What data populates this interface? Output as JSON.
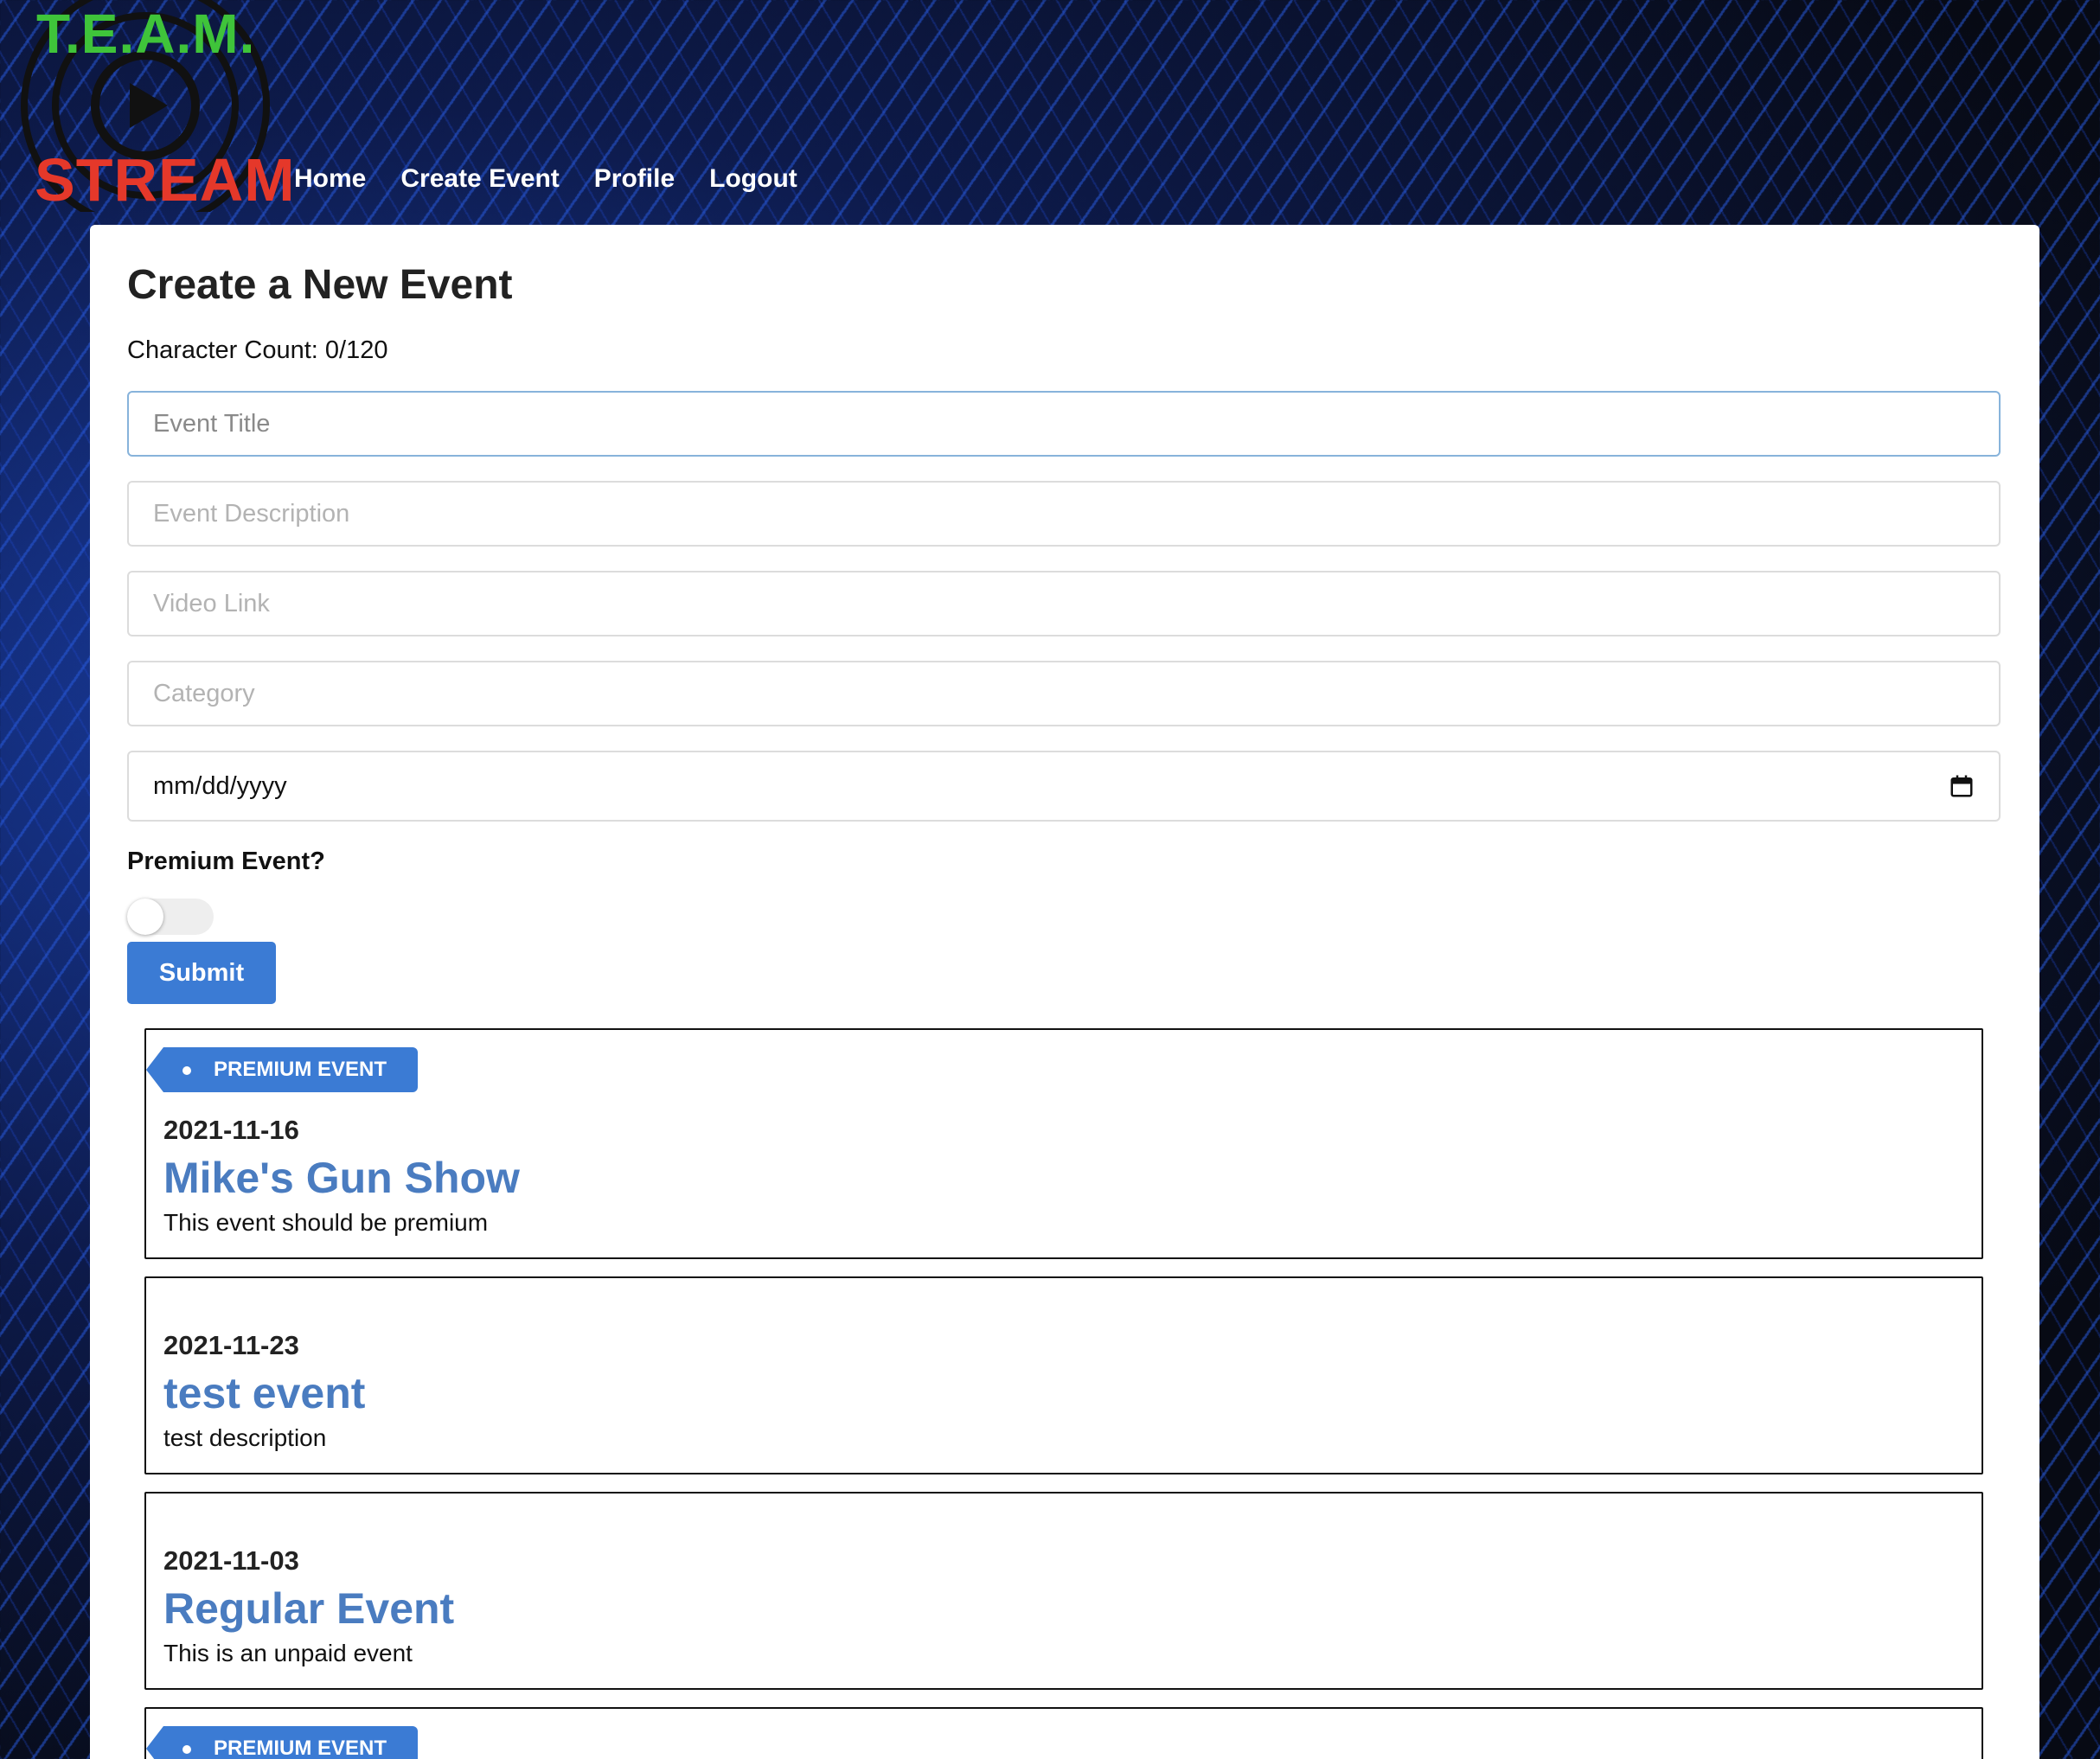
{
  "brand": {
    "top": "T.E.A.M.",
    "bottom": "STREAM"
  },
  "nav": {
    "items": [
      {
        "label": "Home"
      },
      {
        "label": "Create Event"
      },
      {
        "label": "Profile"
      },
      {
        "label": "Logout"
      }
    ]
  },
  "form": {
    "title": "Create a New Event",
    "char_count": "Character Count: 0/120",
    "fields": {
      "title_placeholder": "Event Title",
      "description_placeholder": "Event Description",
      "video_placeholder": "Video Link",
      "category_placeholder": "Category",
      "date_value": "mm/dd/yyyy"
    },
    "premium_label": "Premium Event?",
    "premium_enabled": false,
    "submit_label": "Submit"
  },
  "events": [
    {
      "premium": true,
      "tag": "PREMIUM EVENT",
      "date": "2021-11-16",
      "title": "Mike's Gun Show",
      "description": "This event should be premium"
    },
    {
      "premium": false,
      "date": "2021-11-23",
      "title": "test event",
      "description": "test description"
    },
    {
      "premium": false,
      "date": "2021-11-03",
      "title": "Regular Event",
      "description": "This is an unpaid event"
    },
    {
      "premium": true,
      "tag": "PREMIUM EVENT",
      "date": "",
      "title": "",
      "description": ""
    }
  ],
  "colors": {
    "accent": "#3b7bd4",
    "title_link": "#4a7cc0",
    "logo_green": "#3fc43a",
    "logo_red": "#e5382a"
  }
}
